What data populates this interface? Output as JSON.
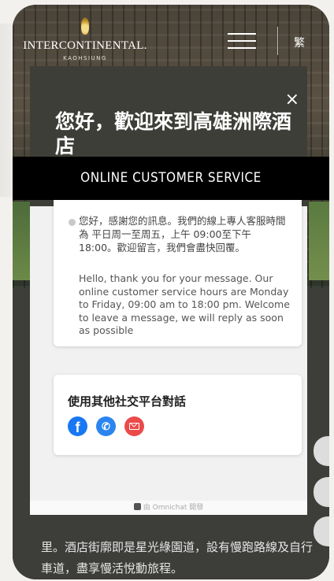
{
  "header": {
    "brand_name": "INTERCONTINENTAL.",
    "brand_city": "KAOHSIUNG",
    "lang_label": "繁"
  },
  "chat": {
    "close_label": "×",
    "greeting": "您好，歡迎來到高雄洲際酒店",
    "message_zh": "您好，感謝您的訊息。我們的線上專人客服時間為 平日周一至周五，上午 09:00至下午 18:00。歡迎留言，我們會盡快回覆。",
    "message_en": "Hello,  thank you for your message. Our online customer service hours are Monday to Friday, 09:00 am to 18:00 pm. Welcome to leave a message, we will reply as soon as possible",
    "social_title": "使用其他社交平台對話",
    "social_icons": [
      "facebook-icon",
      "phone-icon",
      "mail-icon"
    ],
    "footer_text": "由 Omnichat 開發"
  },
  "banner": {
    "label": "ONLINE CUSTOMER SERVICE"
  },
  "page": {
    "body_text": "里。酒店街廓即是星光綠園道，設有慢跑路線及自行車道，盡享慢活悅動旅程。"
  },
  "colors": {
    "chat_header": "#3e3e38",
    "banner": "#000000",
    "facebook": "#1877f2",
    "phone": "#2a85f0",
    "mail": "#ea4a49"
  }
}
